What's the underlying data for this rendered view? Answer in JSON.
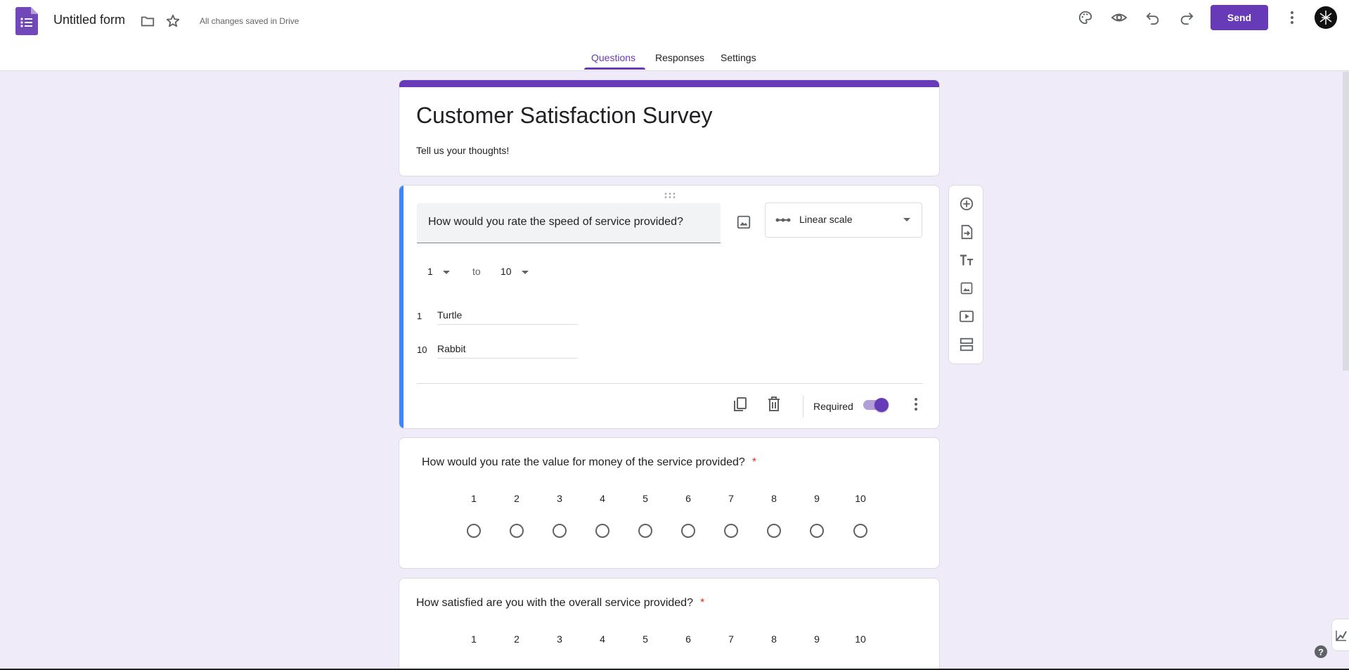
{
  "header": {
    "doc_title": "Untitled form",
    "saved_status": "All changes saved in Drive",
    "send_label": "Send",
    "icons": [
      "forms-logo",
      "folder-icon",
      "star-icon",
      "palette-icon",
      "eye-icon",
      "undo-icon",
      "redo-icon",
      "more-vert-icon",
      "avatar"
    ]
  },
  "tabs": [
    {
      "label": "Questions",
      "active": true
    },
    {
      "label": "Responses",
      "active": false
    },
    {
      "label": "Settings",
      "active": false
    }
  ],
  "form": {
    "title": "Customer Satisfaction Survey",
    "description": "Tell us your thoughts!"
  },
  "active_question": {
    "text": "How would you rate the speed of service provided?",
    "type": "Linear scale",
    "scale_from": "1",
    "scale_to_word": "to",
    "scale_to": "10",
    "low_num": "1",
    "low_label": "Turtle",
    "high_num": "10",
    "high_label": "Rabbit",
    "required_label": "Required",
    "required": true
  },
  "questions": [
    {
      "text": "How would you rate the value for money of the service provided?",
      "required_mark": "*",
      "scale": [
        "1",
        "2",
        "3",
        "4",
        "5",
        "6",
        "7",
        "8",
        "9",
        "10"
      ]
    },
    {
      "text": "How satisfied are you with the overall service provided?",
      "required_mark": "*",
      "scale": [
        "1",
        "2",
        "3",
        "4",
        "5",
        "6",
        "7",
        "8",
        "9",
        "10"
      ]
    }
  ],
  "toolbar": [
    "add-question-icon",
    "import-questions-icon",
    "add-title-icon",
    "add-image-icon",
    "add-video-icon",
    "add-section-icon"
  ],
  "help_label": "?",
  "colors": {
    "brand": "#673ab7",
    "background": "#f0ebf8",
    "active_bar": "#4285f4"
  }
}
